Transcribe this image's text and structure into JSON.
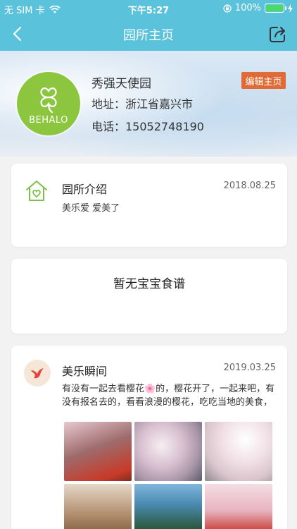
{
  "status_bar": {
    "carrier": "无 SIM 卡",
    "time": "下午5:27",
    "battery": "100%",
    "battery_level": 1.0
  },
  "nav": {
    "title": "园所主页",
    "back_icon": "chevron-left-icon",
    "share_icon": "share-icon"
  },
  "profile": {
    "name": "秀强天使园",
    "address": "地址：浙江省嘉兴市",
    "phone": "电话：15052748190",
    "edit_label": "编辑主页",
    "logo_text": "BEHALO"
  },
  "intro_card": {
    "title": "园所介绍",
    "date": "2018.08.25",
    "description": "美乐爱 爱美了"
  },
  "recipe_card": {
    "empty_text": "暂无宝宝食谱"
  },
  "moments_card": {
    "title": "美乐瞬间",
    "date": "2019.03.25",
    "text": "有没有一起去看樱花🌸的，樱花开了，一起来吧，有没有报名去的，看看浪漫的樱花，吃吃当地的美食，",
    "photos": [
      "cherry-blossom-photo",
      "cherry-blossom-photo",
      "cherry-blossom-photo",
      "cherry-blossom-photo",
      "mountain-photo",
      "cherry-blossom-photo"
    ]
  },
  "colors": {
    "primary": "#5bc2dc",
    "edit_button": "#e06b36",
    "logo_green": "#8cc63f",
    "icon_green": "#7cc04a",
    "moment_red": "#e0443a"
  }
}
